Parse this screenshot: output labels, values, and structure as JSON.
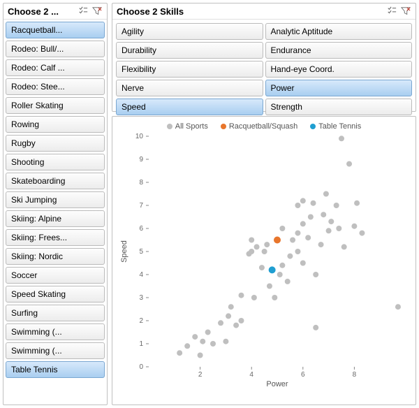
{
  "left_panel": {
    "title": "Choose 2 ...",
    "items": [
      {
        "label": "Racquetball...",
        "selected": true
      },
      {
        "label": "Rodeo: Bull/...",
        "selected": false
      },
      {
        "label": "Rodeo: Calf ...",
        "selected": false
      },
      {
        "label": "Rodeo: Stee...",
        "selected": false
      },
      {
        "label": "Roller Skating",
        "selected": false
      },
      {
        "label": "Rowing",
        "selected": false
      },
      {
        "label": "Rugby",
        "selected": false
      },
      {
        "label": "Shooting",
        "selected": false
      },
      {
        "label": "Skateboarding",
        "selected": false
      },
      {
        "label": "Ski Jumping",
        "selected": false
      },
      {
        "label": "Skiing: Alpine",
        "selected": false
      },
      {
        "label": "Skiing: Frees...",
        "selected": false
      },
      {
        "label": "Skiing: Nordic",
        "selected": false
      },
      {
        "label": "Soccer",
        "selected": false
      },
      {
        "label": "Speed Skating",
        "selected": false
      },
      {
        "label": "Surfing",
        "selected": false
      },
      {
        "label": "Swimming (...",
        "selected": false
      },
      {
        "label": "Swimming (...",
        "selected": false
      },
      {
        "label": "Table Tennis",
        "selected": true
      }
    ]
  },
  "skills_panel": {
    "title": "Choose 2 Skills",
    "items": [
      {
        "label": "Agility",
        "selected": false
      },
      {
        "label": "Analytic Aptitude",
        "selected": false
      },
      {
        "label": "Durability",
        "selected": false
      },
      {
        "label": "Endurance",
        "selected": false
      },
      {
        "label": "Flexibility",
        "selected": false
      },
      {
        "label": "Hand-eye Coord.",
        "selected": false
      },
      {
        "label": "Nerve",
        "selected": false
      },
      {
        "label": "Power",
        "selected": true
      },
      {
        "label": "Speed",
        "selected": true
      },
      {
        "label": "Strength",
        "selected": false
      }
    ]
  },
  "legend": {
    "items": [
      {
        "label": "All Sports",
        "color": "#bfbfbf"
      },
      {
        "label": "Racquetball/Squash",
        "color": "#e8762c"
      },
      {
        "label": "Table Tennis",
        "color": "#1f9ed1"
      }
    ]
  },
  "chart_data": {
    "type": "scatter",
    "title": "",
    "xlabel": "Power",
    "ylabel": "Speed",
    "xlim": [
      0,
      10
    ],
    "ylim": [
      0,
      10
    ],
    "xticks": [
      2,
      4,
      6,
      8
    ],
    "yticks": [
      0,
      1,
      2,
      3,
      4,
      5,
      6,
      7,
      8,
      9,
      10
    ],
    "series": [
      {
        "name": "All Sports",
        "color": "#bfbfbf",
        "points": [
          [
            1.2,
            0.6
          ],
          [
            1.5,
            0.9
          ],
          [
            1.8,
            1.3
          ],
          [
            2.0,
            0.5
          ],
          [
            2.1,
            1.1
          ],
          [
            2.3,
            1.5
          ],
          [
            2.5,
            1.0
          ],
          [
            2.8,
            1.9
          ],
          [
            3.0,
            1.1
          ],
          [
            3.1,
            2.2
          ],
          [
            3.2,
            2.6
          ],
          [
            3.4,
            1.8
          ],
          [
            3.6,
            2.0
          ],
          [
            3.6,
            3.1
          ],
          [
            3.9,
            4.9
          ],
          [
            4.0,
            5.0
          ],
          [
            4.0,
            5.5
          ],
          [
            4.1,
            3.0
          ],
          [
            4.2,
            5.2
          ],
          [
            4.4,
            4.3
          ],
          [
            4.5,
            5.0
          ],
          [
            4.6,
            5.3
          ],
          [
            4.7,
            3.5
          ],
          [
            4.9,
            3.0
          ],
          [
            5.1,
            4.0
          ],
          [
            5.2,
            4.4
          ],
          [
            5.2,
            6.0
          ],
          [
            5.4,
            3.7
          ],
          [
            5.5,
            4.8
          ],
          [
            5.6,
            5.5
          ],
          [
            5.8,
            5.0
          ],
          [
            5.8,
            5.8
          ],
          [
            5.8,
            7.0
          ],
          [
            6.0,
            4.5
          ],
          [
            6.0,
            6.2
          ],
          [
            6.0,
            7.2
          ],
          [
            6.2,
            5.6
          ],
          [
            6.3,
            6.5
          ],
          [
            6.4,
            7.1
          ],
          [
            6.5,
            1.7
          ],
          [
            6.5,
            4.0
          ],
          [
            6.7,
            5.3
          ],
          [
            6.8,
            6.6
          ],
          [
            6.9,
            7.5
          ],
          [
            7.0,
            5.9
          ],
          [
            7.1,
            6.3
          ],
          [
            7.3,
            7.0
          ],
          [
            7.4,
            6.0
          ],
          [
            7.5,
            9.9
          ],
          [
            7.6,
            5.2
          ],
          [
            7.8,
            8.8
          ],
          [
            8.0,
            6.1
          ],
          [
            8.1,
            7.1
          ],
          [
            8.3,
            5.8
          ],
          [
            9.7,
            2.6
          ]
        ]
      },
      {
        "name": "Racquetball/Squash",
        "color": "#e8762c",
        "points": [
          [
            5.0,
            5.5
          ]
        ]
      },
      {
        "name": "Table Tennis",
        "color": "#1f9ed1",
        "points": [
          [
            4.8,
            4.2
          ]
        ]
      }
    ]
  }
}
